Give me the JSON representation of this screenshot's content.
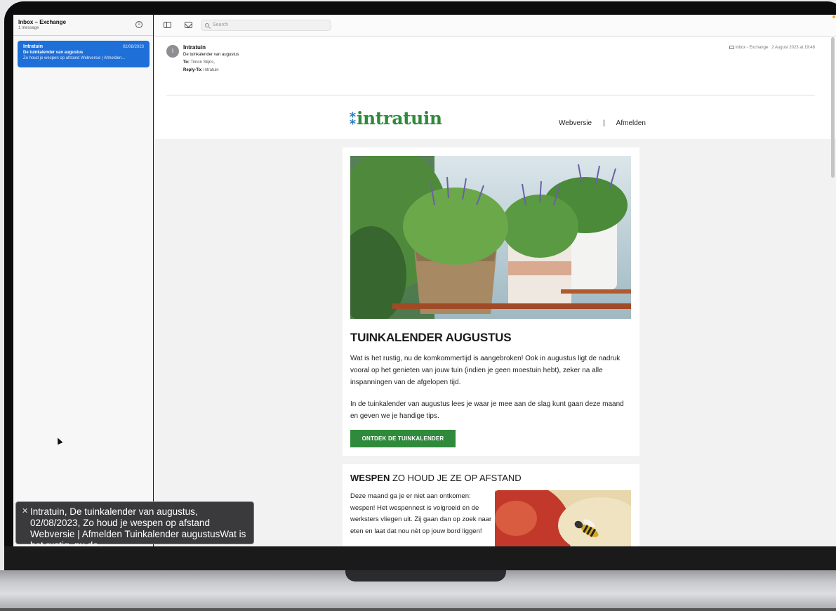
{
  "sidebar": {
    "mailbox_title": "Inbox – Exchange",
    "message_count": "1 message",
    "messages": [
      {
        "from": "Intratuin",
        "date": "02/08/2023",
        "subject": "De tuinkalender van augustus",
        "preview": "Zo houd je wespen op afstand Webversie | Afmelden..."
      }
    ]
  },
  "toolbar": {
    "search_placeholder": "Search"
  },
  "header": {
    "avatar_initial": "I",
    "from": "Intratuin",
    "subject": "De tuinkalender van augustus",
    "to_label": "To:",
    "to_value": "Timon Stijns,",
    "reply_label": "Reply-To:",
    "reply_value": "Intratuin",
    "mailbox": "Inbox - Exchange",
    "datetime": "2 August 2023 at 19:48"
  },
  "email": {
    "logo_text": "intratuin",
    "nav": {
      "webversion": "Webversie",
      "separator": "|",
      "unsubscribe": "Afmelden"
    },
    "section1": {
      "title": "TUINKALENDER AUGUSTUS",
      "para1": "Wat is het rustig, nu de komkommertijd is aangebroken! Ook in augustus ligt de nadruk vooral op het genieten van jouw tuin (indien je geen moestuin hebt), zeker na alle inspanningen van de afgelopen tijd.",
      "para2": "In de tuinkalender van augustus lees je waar je mee aan de slag kunt gaan deze maand en geven we je handige tips.",
      "cta": "ONTDEK DE TUINKALENDER"
    },
    "section2": {
      "title_bold": "WESPEN",
      "title_rest": "ZO HOUD JE ZE OP AFSTAND",
      "para": "Deze maand ga je er niet aan ontkomen: wespen! Het wespennest is volgroeid en de werksters vliegen uit. Zij gaan dan op zoek naar eten en laat dat nou nèt op jouw bord liggen!"
    }
  },
  "notification": {
    "text": "Intratuin, De tuinkalender van augustus, 02/08/2023, Zo houd je wespen op afstand Webversie | Afmelden Tuinkalender augustusWat is het rustig, nu de"
  },
  "colors": {
    "accent_blue": "#1f6fd8",
    "brand_green": "#2f8a3c",
    "logo_blue": "#2b7fc8"
  }
}
